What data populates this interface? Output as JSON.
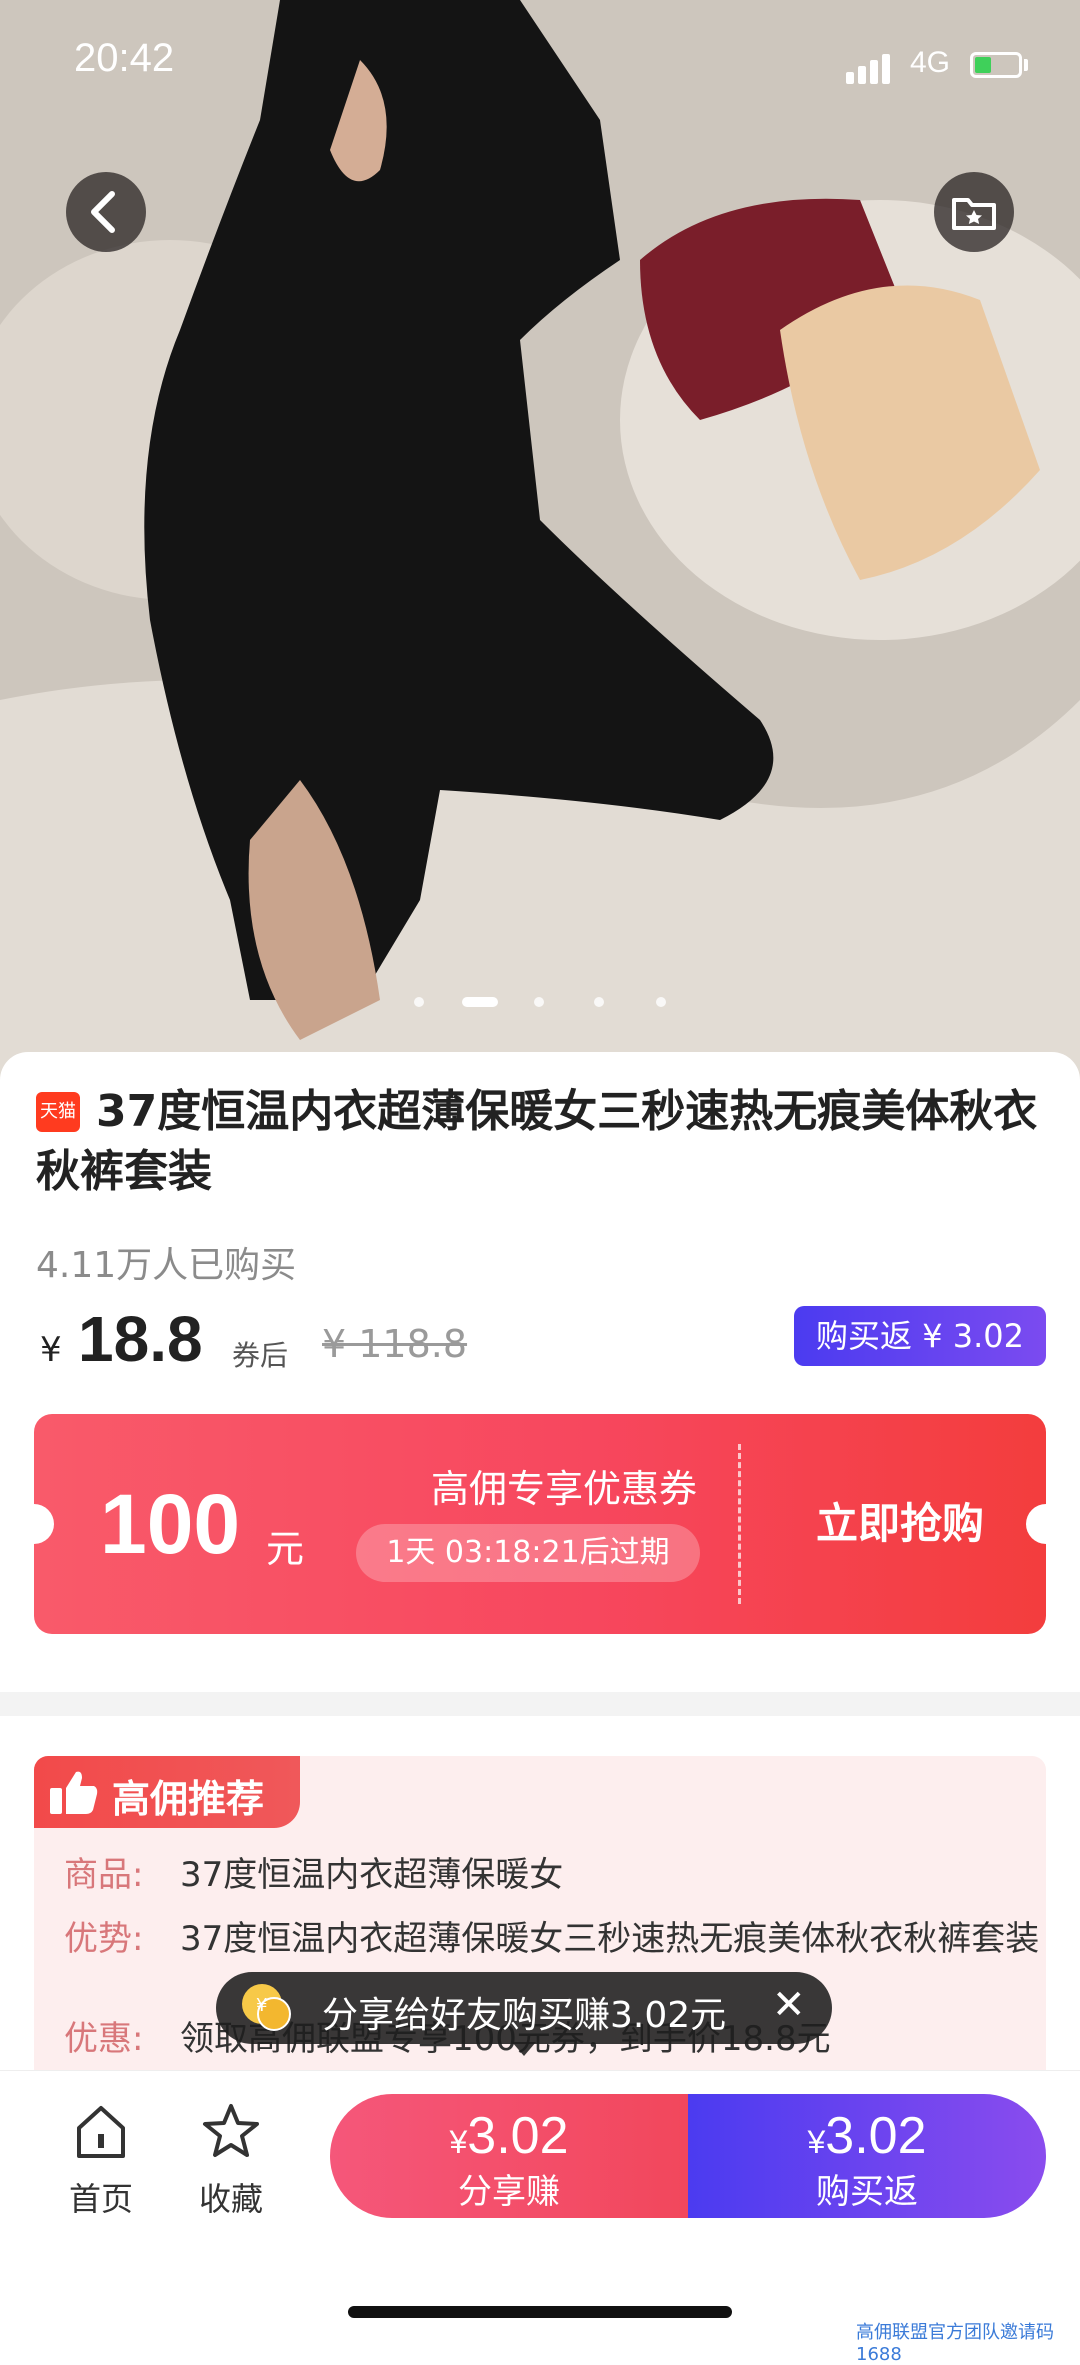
{
  "status_bar": {
    "time": "20:42",
    "network": "4G"
  },
  "hero": {
    "slide_count": 5,
    "active_index": 1
  },
  "product": {
    "platform_badge": "天猫",
    "title": "37度恒温内衣超薄保暖女三秒速热无痕美体秋衣秋裤套装",
    "sales": "4.11万人已购买",
    "currency": "¥",
    "price": "18.8",
    "after_coupon": "券后",
    "original_price": "¥ 118.8",
    "rebate_tag": "购买返 ¥ 3.02"
  },
  "coupon": {
    "amount": "100",
    "unit": "元",
    "name": "高佣专享优惠券",
    "expire": "1天 03:18:21后过期",
    "action": "立即抢购"
  },
  "recommend": {
    "header": "高佣推荐",
    "rows": [
      {
        "key": "商品:",
        "value": "37度恒温内衣超薄保暖女"
      },
      {
        "key": "优势:",
        "value": "37度恒温内衣超薄保暖女三秒速热无痕美体秋衣秋裤套装"
      },
      {
        "key": "优惠:",
        "value": "领取高佣联盟专享100元券，到手价18.8元"
      }
    ]
  },
  "toast": {
    "text": "分享给好友购买赚3.02元",
    "close": "✕"
  },
  "bottom_bar": {
    "home_label": "首页",
    "fav_label": "收藏",
    "share": {
      "yen": "¥",
      "amount": "3.02",
      "label": "分享赚"
    },
    "buy": {
      "yen": "¥",
      "amount": "3.02",
      "label": "购买返"
    }
  },
  "watermark": "高佣联盟官方团队邀请码1688",
  "colors": {
    "accent_red": "#f2475c",
    "accent_purple": "#5b3ff0"
  }
}
